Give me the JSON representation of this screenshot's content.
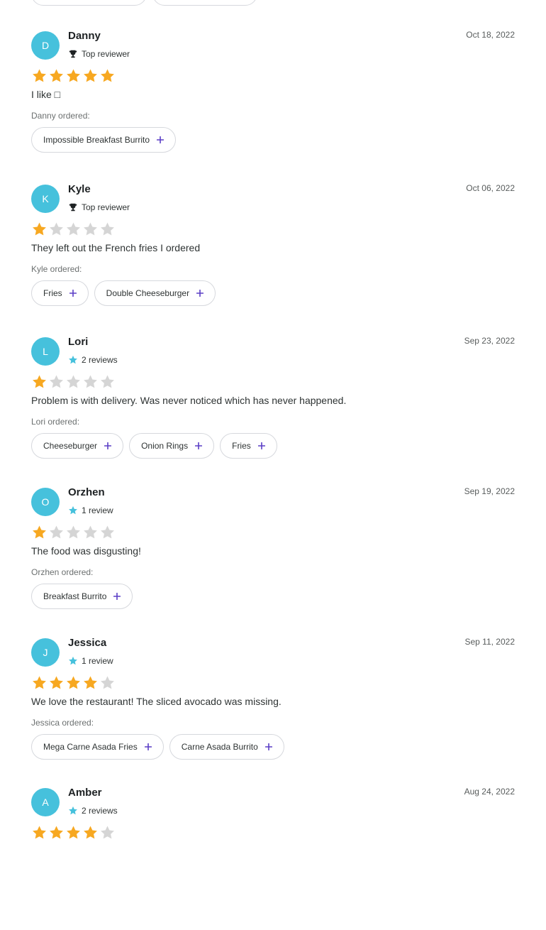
{
  "colors": {
    "avatar": "#46c1dc",
    "star_filled": "#f7a821",
    "star_empty": "#d5d5d5",
    "plus": "#5b3fc6",
    "badge_star": "#46c1dc",
    "trophy": "#1d2123"
  },
  "reviews": [
    {
      "initial": "D",
      "name": "Danny",
      "badge": "Top reviewer",
      "badge_icon": "trophy-icon",
      "date": "Oct 18, 2022",
      "rating": 5,
      "text": "I like □",
      "ordered_label": "Danny ordered:",
      "items": [
        "Impossible Breakfast Burrito"
      ]
    },
    {
      "initial": "K",
      "name": "Kyle",
      "badge": "Top reviewer",
      "badge_icon": "trophy-icon",
      "date": "Oct 06, 2022",
      "rating": 1,
      "text": "They left out the French fries I ordered",
      "ordered_label": "Kyle ordered:",
      "items": [
        "Fries",
        "Double Cheeseburger"
      ]
    },
    {
      "initial": "L",
      "name": "Lori",
      "badge": "2 reviews",
      "badge_icon": "star-badge-icon",
      "date": "Sep 23, 2022",
      "rating": 1,
      "text": "Problem is with delivery. Was never noticed which has never happened.",
      "ordered_label": "Lori ordered:",
      "items": [
        "Cheeseburger",
        "Onion Rings",
        "Fries"
      ]
    },
    {
      "initial": "O",
      "name": "Orzhen",
      "badge": "1 review",
      "badge_icon": "star-badge-icon",
      "date": "Sep 19, 2022",
      "rating": 1,
      "text": "The food was disgusting!",
      "ordered_label": "Orzhen ordered:",
      "items": [
        "Breakfast Burrito"
      ]
    },
    {
      "initial": "J",
      "name": "Jessica",
      "badge": "1 review",
      "badge_icon": "star-badge-icon",
      "date": "Sep 11, 2022",
      "rating": 4,
      "text": "We love the restaurant! The sliced avocado was missing.",
      "ordered_label": "Jessica ordered:",
      "items": [
        "Mega Carne Asada Fries",
        "Carne Asada Burrito"
      ]
    },
    {
      "initial": "A",
      "name": "Amber",
      "badge": "2 reviews",
      "badge_icon": "star-badge-icon",
      "date": "Aug 24, 2022",
      "rating": 4,
      "text": "",
      "ordered_label": "",
      "items": []
    }
  ]
}
